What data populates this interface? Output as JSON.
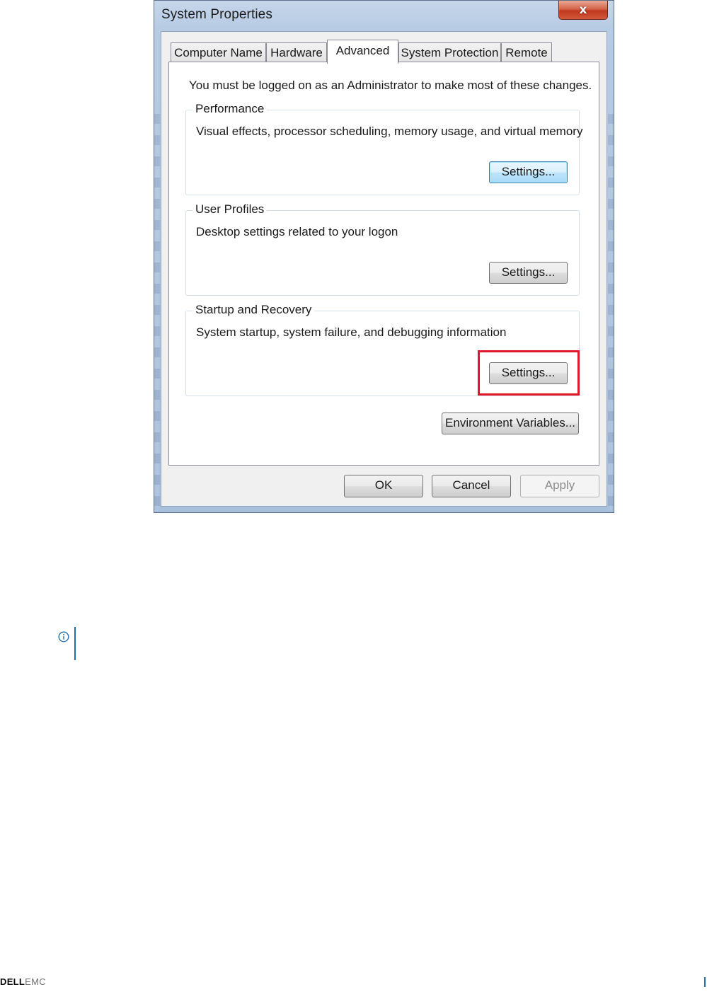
{
  "window": {
    "title": "System Properties",
    "close_label": "x"
  },
  "tabs": [
    {
      "label": "Computer Name",
      "active": false
    },
    {
      "label": "Hardware",
      "active": false
    },
    {
      "label": "Advanced",
      "active": true
    },
    {
      "label": "System Protection",
      "active": false
    },
    {
      "label": "Remote",
      "active": false
    }
  ],
  "advanced": {
    "notice": "You must be logged on as an Administrator to make most of these changes.",
    "groups": [
      {
        "title": "Performance",
        "description": "Visual effects, processor scheduling, memory usage, and virtual memory",
        "button_label": "Settings..."
      },
      {
        "title": "User Profiles",
        "description": "Desktop settings related to your logon",
        "button_label": "Settings..."
      },
      {
        "title": "Startup and Recovery",
        "description": "System startup, system failure, and debugging information",
        "button_label": "Settings..."
      }
    ],
    "env_button_label": "Environment Variables..."
  },
  "dialog_buttons": {
    "ok": "OK",
    "cancel": "Cancel",
    "apply": "Apply"
  },
  "highlight_color": "#e0162b",
  "info_icon": "info-circle-icon",
  "footer": {
    "brand_dell": "DELL",
    "brand_emc": "EMC"
  }
}
